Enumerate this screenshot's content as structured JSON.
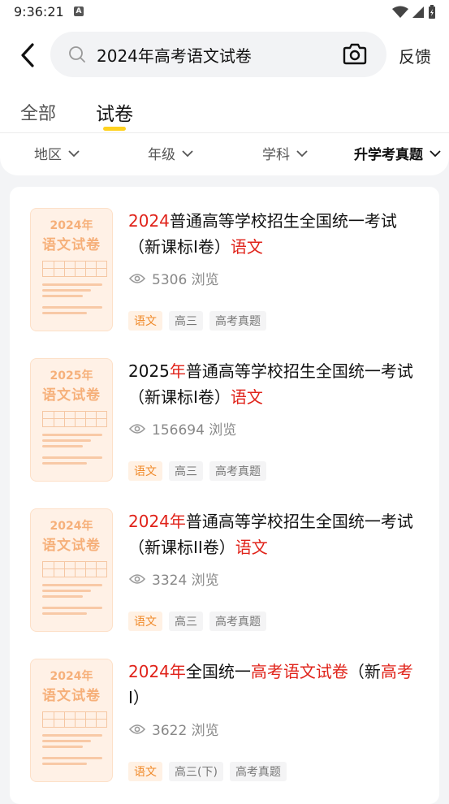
{
  "status": {
    "time": "9:36:21",
    "a_badge": "A"
  },
  "search": {
    "query": "2024年高考语文试卷",
    "feedback": "反馈"
  },
  "tabs": [
    {
      "label": "全部"
    },
    {
      "label": "试卷"
    }
  ],
  "filters": [
    {
      "label": "地区"
    },
    {
      "label": "年级"
    },
    {
      "label": "学科"
    },
    {
      "label": "升学考真题"
    }
  ],
  "items": [
    {
      "thumb_year": "2024年",
      "thumb_name": "语文试卷",
      "title_parts": [
        {
          "t": "2024",
          "hl": true
        },
        {
          "t": "普通高等学校招生全国统一考试（新课标I卷）",
          "hl": false
        },
        {
          "t": "语文",
          "hl": true
        }
      ],
      "views": "5306 浏览",
      "tags": [
        "语文",
        "高三",
        "高考真题"
      ]
    },
    {
      "thumb_year": "2025年",
      "thumb_name": "语文试卷",
      "title_parts": [
        {
          "t": "2025",
          "hl": false
        },
        {
          "t": "年",
          "hl": true
        },
        {
          "t": "普通高等学校招生全国统一考试（新课标I卷）",
          "hl": false
        },
        {
          "t": "语文",
          "hl": true
        }
      ],
      "views": "156694 浏览",
      "tags": [
        "语文",
        "高三",
        "高考真题"
      ]
    },
    {
      "thumb_year": "2024年",
      "thumb_name": "语文试卷",
      "title_parts": [
        {
          "t": "2024年",
          "hl": true
        },
        {
          "t": "普通高等学校招生全国统一考试（新课标II卷）",
          "hl": false
        },
        {
          "t": "语文",
          "hl": true
        }
      ],
      "views": "3324 浏览",
      "tags": [
        "语文",
        "高三",
        "高考真题"
      ]
    },
    {
      "thumb_year": "2024年",
      "thumb_name": "语文试卷",
      "title_parts": [
        {
          "t": "2024年",
          "hl": true
        },
        {
          "t": "全国统一",
          "hl": false
        },
        {
          "t": "高考语文试卷",
          "hl": true
        },
        {
          "t": "（新",
          "hl": false
        },
        {
          "t": "高考",
          "hl": true
        },
        {
          "t": "I）",
          "hl": false
        }
      ],
      "views": "3622 浏览",
      "tags": [
        "语文",
        "高三(下)",
        "高考真题"
      ]
    }
  ],
  "colors": {
    "highlight": "#e0231a",
    "tab_underline": "#ffd21f",
    "subject_tag": "#f08a2a"
  }
}
